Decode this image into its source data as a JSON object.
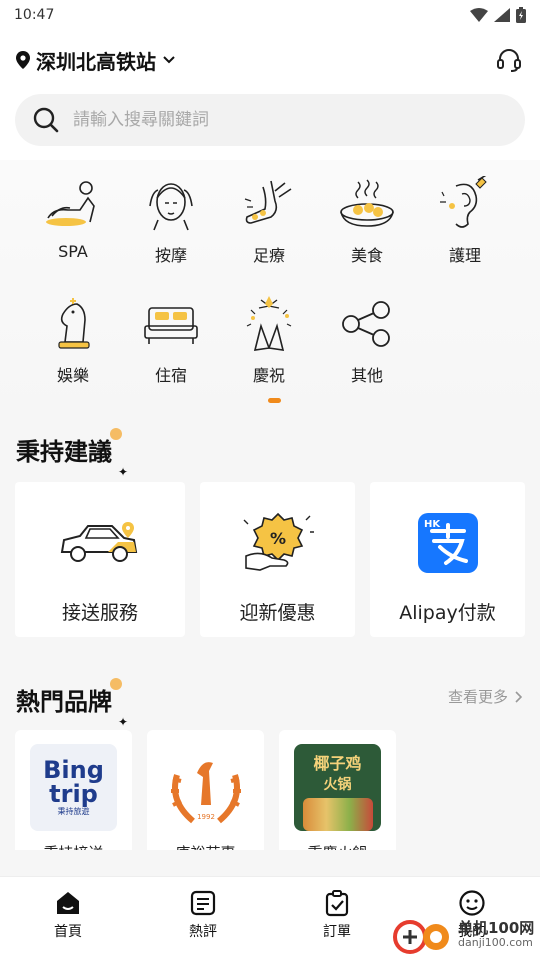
{
  "status": {
    "time": "10:47"
  },
  "location": {
    "name": "深圳北高铁站"
  },
  "search": {
    "placeholder": "請輸入搜尋關鍵詞"
  },
  "categories": [
    {
      "label": "SPA",
      "icon": "spa-massage-icon"
    },
    {
      "label": "按摩",
      "icon": "massage-head-icon"
    },
    {
      "label": "足療",
      "icon": "foot-care-icon"
    },
    {
      "label": "美食",
      "icon": "food-bowl-icon"
    },
    {
      "label": "護理",
      "icon": "ear-care-icon"
    },
    {
      "label": "娛樂",
      "icon": "chess-knight-icon"
    },
    {
      "label": "住宿",
      "icon": "bed-icon"
    },
    {
      "label": "慶祝",
      "icon": "fireworks-icon"
    },
    {
      "label": "其他",
      "icon": "share-nodes-icon"
    }
  ],
  "recommend": {
    "title": "秉持建議",
    "cards": [
      {
        "label": "接送服務",
        "icon": "car-pickup-icon"
      },
      {
        "label": "迎新優惠",
        "icon": "discount-hand-icon"
      },
      {
        "label": "Alipay付款",
        "icon": "alipay-hk-icon"
      }
    ]
  },
  "brands": {
    "title": "熱門品牌",
    "more": "查看更多",
    "items": [
      {
        "name": "秉持接送",
        "logo_text_1": "Bing",
        "logo_text_2": "trip",
        "logo_sub": "秉持旅遊"
      },
      {
        "name": "唐裕茹惠",
        "logo_text_1": "1992"
      },
      {
        "name": "重慶火鍋",
        "logo_text_1": "椰子鸡",
        "logo_text_2": "火锅"
      }
    ]
  },
  "tabs": [
    {
      "label": "首頁",
      "icon": "home-icon"
    },
    {
      "label": "熱評",
      "icon": "review-icon"
    },
    {
      "label": "訂單",
      "icon": "order-clipboard-icon"
    },
    {
      "label": "我的",
      "icon": "profile-smile-icon"
    }
  ],
  "watermark": {
    "main": "单机100网",
    "sub": "danji100.com"
  },
  "colors": {
    "accent": "#f08a1b",
    "alipay": "#1677ff",
    "brand_blue": "#1f3c8c",
    "brand_orange": "#e6772a"
  }
}
